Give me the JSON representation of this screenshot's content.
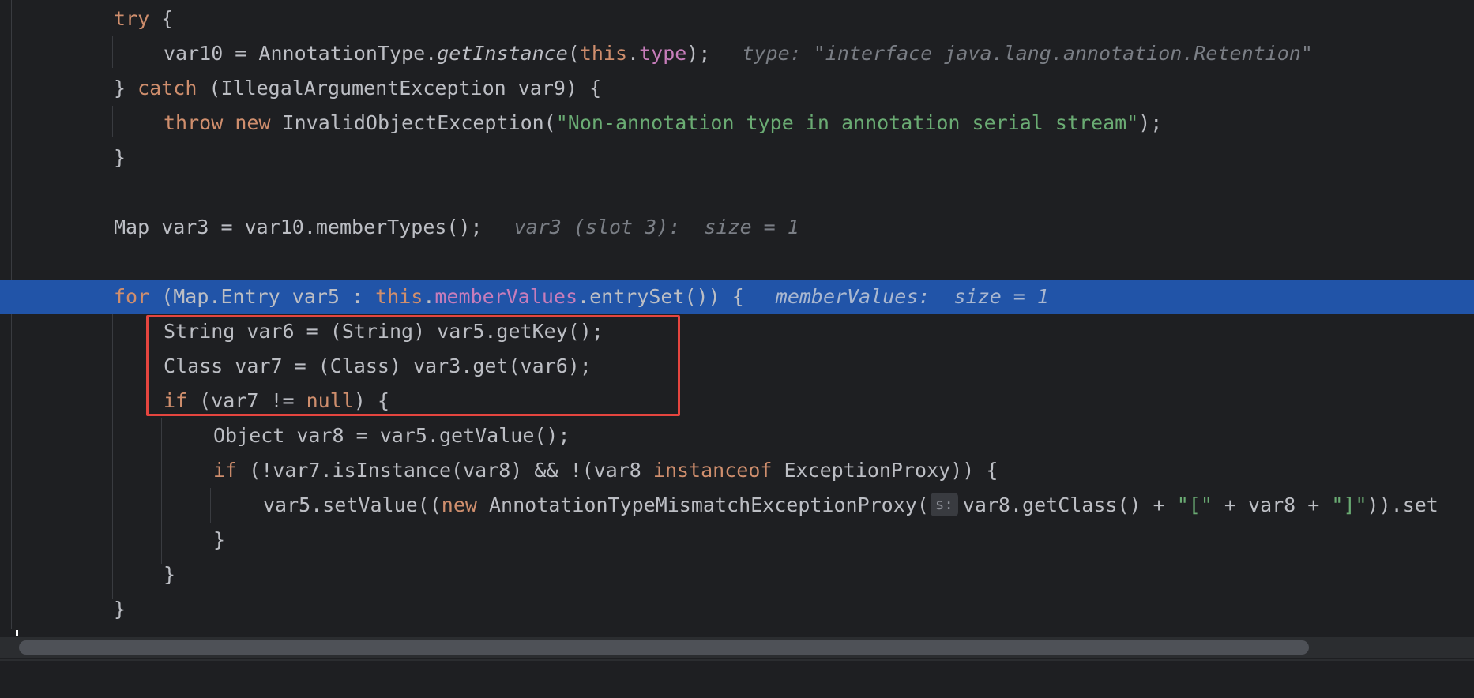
{
  "colors": {
    "background": "#1e1f22",
    "keyword": "#cf8e6d",
    "field": "#c77dbb",
    "string": "#6aab73",
    "text": "#bcbec4",
    "inline_hint": "#7a7e85",
    "execution_line": "#2154a8",
    "highlight_box": "#e5453f"
  },
  "code": {
    "l1": {
      "kw_try": "try",
      "rest": " {"
    },
    "l2": {
      "pre": "var10 = AnnotationType.",
      "method": "getInstance",
      "paren": "(",
      "this": "this",
      "dot": ".",
      "field": "type",
      "post": ");",
      "hint": "type: \"interface java.lang.annotation.Retention\""
    },
    "l3": {
      "pre": "} ",
      "kw_catch": "catch",
      "post": " (IllegalArgumentException var9) {"
    },
    "l4": {
      "kw_throw": "throw",
      "kw_new": "new",
      "pre": "InvalidObjectException(",
      "string": "\"Non-annotation type in annotation serial stream\"",
      "post": ");"
    },
    "l5": {
      "text": "}"
    },
    "l7": {
      "text": "Map var3 = var10.memberTypes();",
      "hint": "var3 (slot_3):  size = 1"
    },
    "l9": {
      "kw_for": "for",
      "pre": " (Map.Entry var5 : ",
      "this": "this",
      "dot": ".",
      "field": "memberValues",
      "post": ".entrySet()) {",
      "hint": "memberValues:  size = 1"
    },
    "l10": {
      "text": "String var6 = (String) var5.getKey();"
    },
    "l11": {
      "text": "Class var7 = (Class) var3.get(var6);"
    },
    "l12": {
      "kw_if": "if",
      "pre": " (var7 != ",
      "kw_null": "null",
      "post": ") {"
    },
    "l13": {
      "text": "Object var8 = var5.getValue();"
    },
    "l14": {
      "kw_if": "if",
      "pre": " (!var7.isInstance(var8) && !(var8 ",
      "kw_instanceof": "instanceof",
      "post": " ExceptionProxy)) {"
    },
    "l15": {
      "pre": "var5.setValue((",
      "kw_new": "new",
      "mid": " AnnotationTypeMismatchExceptionProxy(",
      "param_hint": "s:",
      "mid2": "var8.getClass() + ",
      "str1": "\"[\"",
      "mid3": " + var8 + ",
      "str2": "\"]\"",
      "post": ")).set"
    },
    "l16": {
      "text": "}"
    },
    "l17": {
      "text": "}"
    },
    "l18": {
      "text": "}"
    }
  }
}
